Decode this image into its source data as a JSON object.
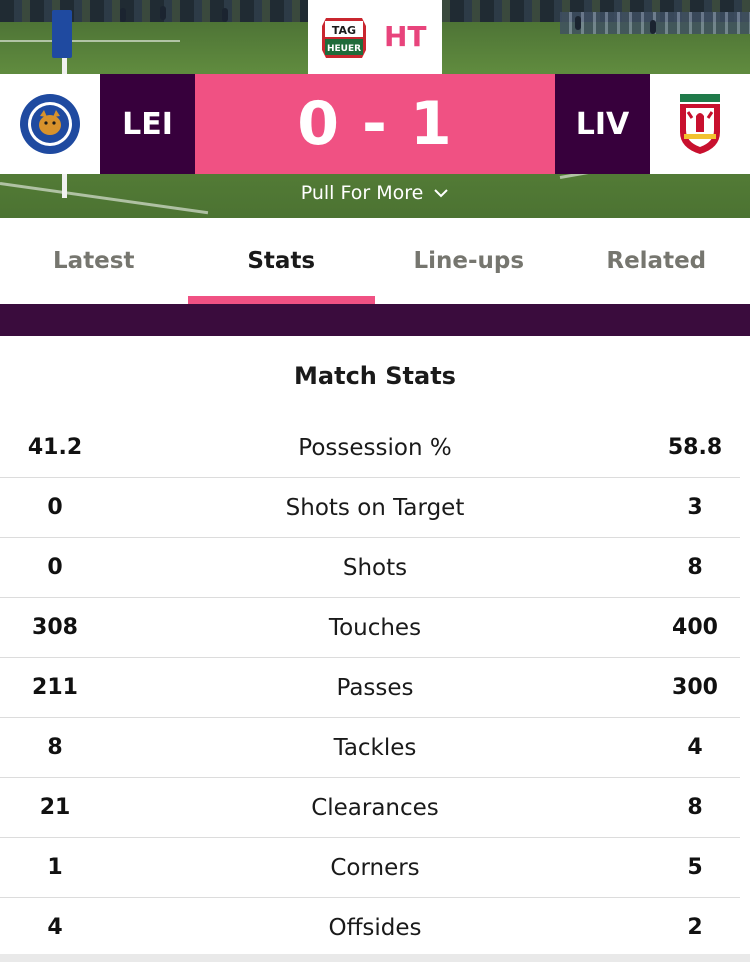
{
  "header": {
    "brand_logo_text": "TAG HEUER",
    "status": "HT",
    "home_team": {
      "code": "LEI",
      "badge_text": "LEICESTER CITY FOOTBALL CLUB"
    },
    "away_team": {
      "code": "LIV",
      "badge_text": "LIVERPOOL"
    },
    "score": {
      "home": "0",
      "separator": "-",
      "away": "1"
    },
    "pull_label": "Pull For More"
  },
  "tabs": [
    {
      "label": "Latest",
      "active": false
    },
    {
      "label": "Stats",
      "active": true
    },
    {
      "label": "Line-ups",
      "active": false
    },
    {
      "label": "Related",
      "active": false
    }
  ],
  "match_stats": {
    "title": "Match Stats",
    "rows": [
      {
        "home": "41.2",
        "label": "Possession %",
        "away": "58.8"
      },
      {
        "home": "0",
        "label": "Shots on Target",
        "away": "3"
      },
      {
        "home": "0",
        "label": "Shots",
        "away": "8"
      },
      {
        "home": "308",
        "label": "Touches",
        "away": "400"
      },
      {
        "home": "211",
        "label": "Passes",
        "away": "300"
      },
      {
        "home": "8",
        "label": "Tackles",
        "away": "4"
      },
      {
        "home": "21",
        "label": "Clearances",
        "away": "8"
      },
      {
        "home": "1",
        "label": "Corners",
        "away": "5"
      },
      {
        "home": "4",
        "label": "Offsides",
        "away": "2"
      }
    ]
  },
  "colors": {
    "accent_pink": "#f05183",
    "purple": "#37003c",
    "ht_pink": "#e8447c"
  },
  "icons": {
    "brand": "tag-heuer-logo",
    "home_badge": "leicester-city-crest",
    "away_badge": "liverpool-crest",
    "pull": "chevron-down-icon"
  }
}
